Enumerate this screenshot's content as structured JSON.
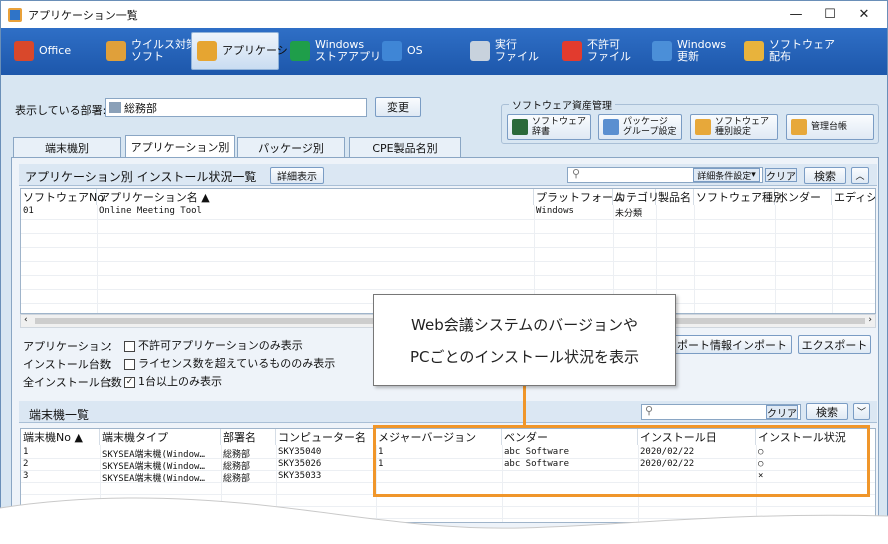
{
  "window": {
    "title": "アプリケーション一覧",
    "minimize": "—",
    "maximize": "☐",
    "close": "✕"
  },
  "toolbar": [
    {
      "label": "Office",
      "icon": "office-icon",
      "color": "#d9482b"
    },
    {
      "label": "ウイルス対策\nソフト",
      "icon": "antivirus-icon",
      "color": "#e0a03a"
    },
    {
      "label": "アプリケーション",
      "icon": "application-icon",
      "color": "#e6a531"
    },
    {
      "label": "Windows\nストアアプリ",
      "icon": "store-icon",
      "color": "#1f9e4a"
    },
    {
      "label": "OS",
      "icon": "os-icon",
      "color": "#3f86d6"
    },
    {
      "label": "実行\nファイル",
      "icon": "exe-icon",
      "color": "#c8d2dd"
    },
    {
      "label": "不許可\nファイル",
      "icon": "forbidden-icon",
      "color": "#e23b2e"
    },
    {
      "label": "Windows\n更新",
      "icon": "windows-update-icon",
      "color": "#4b8fd8"
    },
    {
      "label": "ソフトウェア\n配布",
      "icon": "distribution-icon",
      "color": "#e8b33c"
    }
  ],
  "dept": {
    "label": "表示している部署:",
    "value": "総務部",
    "change": "変更"
  },
  "asset": {
    "title": "ソフトウェア資産管理",
    "buttons": [
      "ソフトウェア\n辞書",
      "パッケージ\nグループ設定",
      "ソフトウェア\n種別設定",
      "管理台帳"
    ]
  },
  "tabs": [
    "端末機別",
    "アプリケーション別",
    "パッケージ別",
    "CPE製品名別"
  ],
  "section1": {
    "title": "アプリケーション別 インストール状況一覧",
    "detail": "詳細表示",
    "adv": "詳細条件設定",
    "clear": "クリア",
    "search": "検索",
    "columns": [
      "ソフトウェアNo.",
      "アプリケーション名 ▲",
      "プラットフォーム",
      "カテゴリ",
      "製品名",
      "ソフトウェア種別",
      "ベンダー",
      "エディシ"
    ],
    "rows": [
      [
        "01",
        "Online Meeting Tool",
        "Windows",
        "未分類",
        "",
        "",
        "",
        ""
      ]
    ]
  },
  "filters": [
    {
      "label": "アプリケーション",
      "sep": "：",
      "text": "不許可アプリケーションのみ表示",
      "checked": false
    },
    {
      "label": "インストール台数",
      "sep": "：",
      "text": "ライセンス数を超えているもののみ表示",
      "checked": false
    },
    {
      "label": "全インストール台数",
      "sep": "：",
      "text": "1台以上のみ表示",
      "checked": true
    }
  ],
  "import_btn": "レポート情報インポート",
  "export_btn": "エクスポート",
  "section2": {
    "title": "端末機一覧",
    "clear": "クリア",
    "search": "検索",
    "columns": [
      "端末機No ▲",
      "端末機タイプ",
      "部署名",
      "コンピューター名",
      "メジャーバージョン",
      "ベンダー",
      "インストール日",
      "インストール状況"
    ],
    "rows": [
      [
        "1",
        "SKYSEA端末機(Window…",
        "総務部",
        "SKY35040",
        "1",
        "abc Software",
        "2020/02/22",
        "○"
      ],
      [
        "2",
        "SKYSEA端末機(Window…",
        "総務部",
        "SKY35026",
        "1",
        "abc Software",
        "2020/02/22",
        "○"
      ],
      [
        "3",
        "SKYSEA端末機(Window…",
        "総務部",
        "SKY35033",
        "",
        "",
        "",
        "×"
      ]
    ]
  },
  "callout": {
    "line1": "Web会議システムのバージョンや",
    "line2": "PCごとのインストール状況を表示"
  }
}
